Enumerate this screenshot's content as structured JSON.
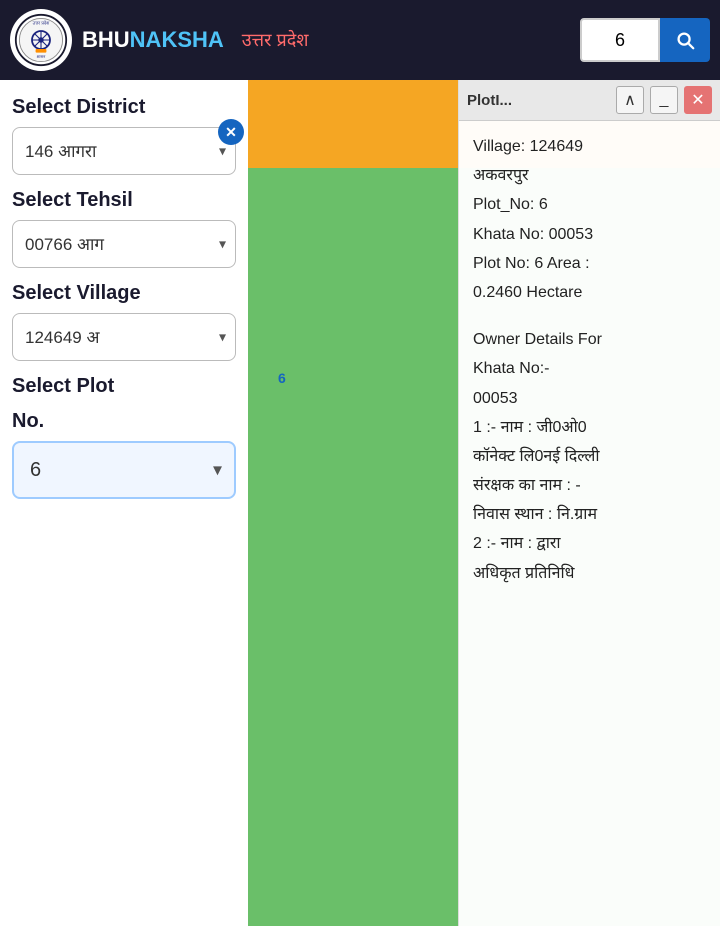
{
  "header": {
    "app_name_part1": "BHU",
    "app_name_part2": "NAKSHA",
    "state_name": "उत्तर प्रदेश",
    "search_value": "6",
    "search_placeholder": "Search"
  },
  "sidebar": {
    "district_label": "Select District",
    "district_value": "146 आगरा",
    "tehsil_label": "Select Tehsil",
    "tehsil_value": "00766 आग",
    "village_label": "Select Village",
    "village_value": "124649 अ",
    "plot_label_line1": "Select Plot",
    "plot_label_line2": "No.",
    "plot_value": "6"
  },
  "info_panel": {
    "title": "PlotI...",
    "village_line": "Village: 124649",
    "village_name": "अकवरपुर",
    "plot_no_line": "Plot_No: 6",
    "khata_no_line": "Khata No: 00053",
    "area_line1": "Plot No: 6 Area :",
    "area_line2": "0.2460 Hectare",
    "owner_header1": "Owner Details For",
    "owner_header2": "Khata No:-",
    "owner_header3": "00053",
    "owner1_line1": "1 :- नाम : जी0ओ0",
    "owner1_line2": "कॉनेक्ट लि0नई दिल्ली",
    "owner1_line3": "संरक्षक का नाम : -",
    "owner1_line4": "निवास स्थान : नि.ग्राम",
    "owner2_line1": "2 :- नाम : द्वारा",
    "owner2_line2": "अधिकृत प्रतिनिधि"
  },
  "map": {
    "plot_number": "6"
  }
}
